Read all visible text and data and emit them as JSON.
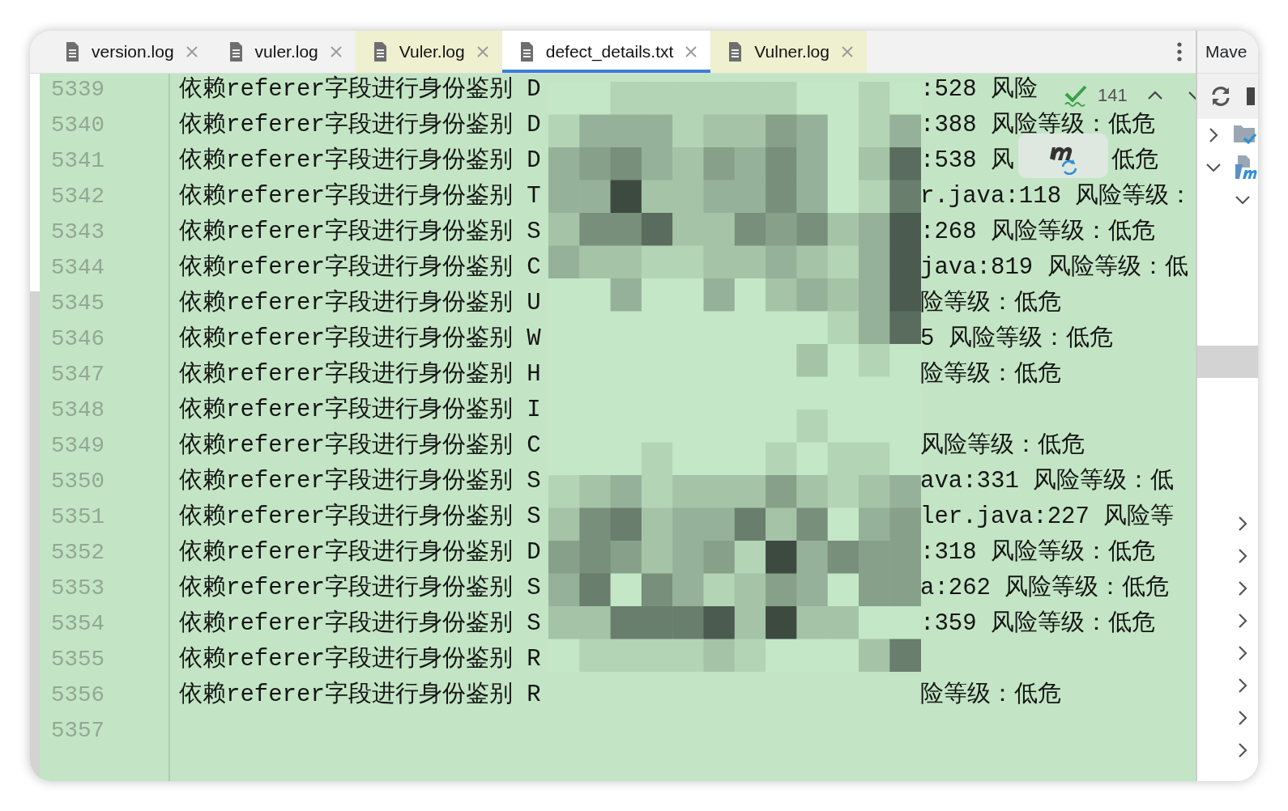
{
  "tabs": [
    {
      "label": "version.log",
      "selected": false,
      "highlighted": false
    },
    {
      "label": "vuler.log",
      "selected": false,
      "highlighted": false
    },
    {
      "label": "Vuler.log",
      "selected": false,
      "highlighted": true
    },
    {
      "label": "defect_details.txt",
      "selected": true,
      "highlighted": false
    },
    {
      "label": "Vulner.log",
      "selected": false,
      "highlighted": true
    }
  ],
  "tool_window": {
    "title": "Mave"
  },
  "editor": {
    "lines": [
      {
        "number": "5339",
        "text": "依赖referer字段进行身份鉴别 D",
        "tail": ":528 风险"
      },
      {
        "number": "5340",
        "text": "依赖referer字段进行身份鉴别 D",
        "tail": ":388 风险等级：低危"
      },
      {
        "number": "5341",
        "text": "依赖referer字段进行身份鉴别 D",
        "tail": ":538 风",
        "tail_end": "低危"
      },
      {
        "number": "5342",
        "text": "依赖referer字段进行身份鉴别 T",
        "tail": "r.java:118 风险等级："
      },
      {
        "number": "5343",
        "text": "依赖referer字段进行身份鉴别 S",
        "tail": ":268 风险等级：低危"
      },
      {
        "number": "5344",
        "text": "依赖referer字段进行身份鉴别 C",
        "tail": "java:819 风险等级：低"
      },
      {
        "number": "5345",
        "text": "依赖referer字段进行身份鉴别 U",
        "tail": "险等级：低危"
      },
      {
        "number": "5346",
        "text": "依赖referer字段进行身份鉴别 W",
        "tail": "5 风险等级：低危"
      },
      {
        "number": "5347",
        "text": "依赖referer字段进行身份鉴别 H",
        "tail": "险等级：低危"
      },
      {
        "number": "5348",
        "text": "依赖referer字段进行身份鉴别 I"
      },
      {
        "number": "5349",
        "text": "依赖referer字段进行身份鉴别 C",
        "tail": "风险等级：低危"
      },
      {
        "number": "5350",
        "text": "依赖referer字段进行身份鉴别 S",
        "tail": "ava:331 风险等级：低"
      },
      {
        "number": "5351",
        "text": "依赖referer字段进行身份鉴别 S",
        "tail": "ler.java:227 风险等"
      },
      {
        "number": "5352",
        "text": "依赖referer字段进行身份鉴别 D",
        "tail": ":318 风险等级：低危"
      },
      {
        "number": "5353",
        "text": "依赖referer字段进行身份鉴别 S",
        "tail": "a:262 风险等级：低危"
      },
      {
        "number": "5354",
        "text": "依赖referer字段进行身份鉴别 S",
        "tail": ":359 风险等级：低危"
      },
      {
        "number": "5355",
        "text": "依赖referer字段进行身份鉴别 R"
      },
      {
        "number": "5356",
        "text": "依赖referer字段进行身份鉴别 R",
        "tail": "险等级：低危"
      },
      {
        "number": "5357"
      }
    ]
  },
  "find": {
    "count": "141"
  },
  "maven_tree": [
    {
      "kind": "folder",
      "expanded": false,
      "selected": false
    },
    {
      "kind": "module",
      "expanded": true,
      "selected": false,
      "children": [
        {
          "expanded": true,
          "selected": false,
          "children": [
            {
              "selected": false
            },
            {
              "selected": false
            },
            {
              "selected": false
            },
            {
              "selected": false
            },
            {
              "selected": true
            },
            {
              "selected": false
            },
            {
              "selected": false
            },
            {
              "selected": false
            },
            {
              "selected": false
            }
          ]
        },
        {
          "expanded": false,
          "selected": false
        },
        {
          "expanded": false,
          "selected": false
        },
        {
          "expanded": false,
          "selected": false
        },
        {
          "expanded": false,
          "selected": false
        },
        {
          "expanded": false,
          "selected": false
        },
        {
          "expanded": false,
          "selected": false
        },
        {
          "expanded": false,
          "selected": false
        },
        {
          "expanded": false,
          "selected": false
        }
      ]
    }
  ]
}
